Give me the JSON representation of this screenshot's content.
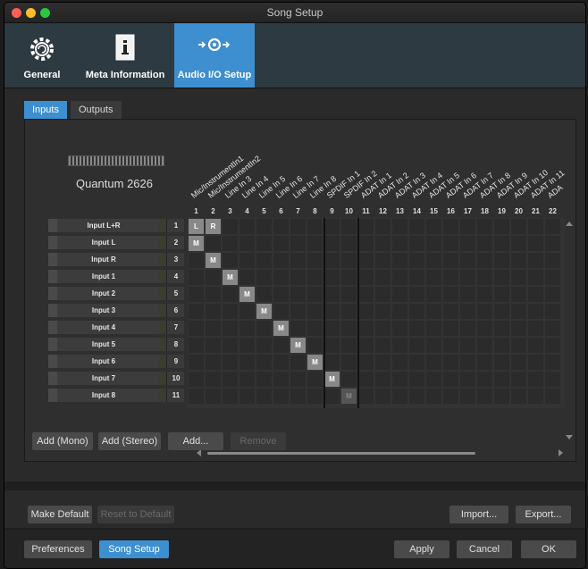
{
  "window": {
    "title": "Song Setup"
  },
  "traffic_lights": {
    "close": "#ff5f57",
    "minimize": "#febc2e",
    "zoom": "#28c840"
  },
  "toolbar": {
    "items": [
      {
        "label": "General",
        "icon": "gear-icon"
      },
      {
        "label": "Meta Information",
        "icon": "info-document-icon"
      },
      {
        "label": "Audio I/O Setup",
        "icon": "audio-io-icon",
        "active": true
      }
    ]
  },
  "tabs": [
    {
      "label": "Inputs",
      "active": true
    },
    {
      "label": "Outputs",
      "active": false
    }
  ],
  "device": {
    "name": "Quantum 2626"
  },
  "columns": [
    {
      "num": "1",
      "name": "Mic/InstrumentIn1"
    },
    {
      "num": "2",
      "name": "Mic/InstrumentIn2"
    },
    {
      "num": "3",
      "name": "Line In 3"
    },
    {
      "num": "4",
      "name": "Line In 4"
    },
    {
      "num": "5",
      "name": "Line In 5"
    },
    {
      "num": "6",
      "name": "Line In 6"
    },
    {
      "num": "7",
      "name": "Line In 7"
    },
    {
      "num": "8",
      "name": "Line In 8"
    },
    {
      "num": "9",
      "name": "SPDIF In 1"
    },
    {
      "num": "10",
      "name": "SPDIF In 2"
    },
    {
      "num": "11",
      "name": "ADAT In 1"
    },
    {
      "num": "12",
      "name": "ADAT In 2"
    },
    {
      "num": "13",
      "name": "ADAT In 3"
    },
    {
      "num": "14",
      "name": "ADAT In 4"
    },
    {
      "num": "15",
      "name": "ADAT In 5"
    },
    {
      "num": "16",
      "name": "ADAT In 6"
    },
    {
      "num": "17",
      "name": "ADAT In 7"
    },
    {
      "num": "18",
      "name": "ADAT In 8"
    },
    {
      "num": "19",
      "name": "ADAT In 9"
    },
    {
      "num": "20",
      "name": "ADAT In 10"
    },
    {
      "num": "21",
      "name": "ADAT In 11"
    },
    {
      "num": "22",
      "name": "ADA"
    }
  ],
  "rows": [
    {
      "name": "Input L+R",
      "num": "1",
      "marks": [
        {
          "col": 0,
          "text": "L"
        },
        {
          "col": 1,
          "text": "R"
        }
      ]
    },
    {
      "name": "Input L",
      "num": "2",
      "marks": [
        {
          "col": 0,
          "text": "M"
        }
      ]
    },
    {
      "name": "Input R",
      "num": "3",
      "marks": [
        {
          "col": 1,
          "text": "M"
        }
      ]
    },
    {
      "name": "Input 1",
      "num": "4",
      "marks": [
        {
          "col": 2,
          "text": "M"
        }
      ]
    },
    {
      "name": "Input 2",
      "num": "5",
      "marks": [
        {
          "col": 3,
          "text": "M"
        }
      ]
    },
    {
      "name": "Input 3",
      "num": "6",
      "marks": [
        {
          "col": 4,
          "text": "M"
        }
      ]
    },
    {
      "name": "Input 4",
      "num": "7",
      "marks": [
        {
          "col": 5,
          "text": "M"
        }
      ]
    },
    {
      "name": "Input 5",
      "num": "8",
      "marks": [
        {
          "col": 6,
          "text": "M"
        }
      ]
    },
    {
      "name": "Input 6",
      "num": "9",
      "marks": [
        {
          "col": 7,
          "text": "M"
        }
      ]
    },
    {
      "name": "Input 7",
      "num": "10",
      "marks": [
        {
          "col": 8,
          "text": "M"
        }
      ]
    },
    {
      "name": "Input 8",
      "num": "11",
      "marks": [
        {
          "col": 9,
          "text": "M",
          "dim": true
        }
      ]
    }
  ],
  "channel_buttons": {
    "add_mono": "Add (Mono)",
    "add_stereo": "Add (Stereo)",
    "add": "Add...",
    "remove": "Remove"
  },
  "default_buttons": {
    "make_default": "Make Default",
    "reset_default": "Reset to Default",
    "import": "Import...",
    "export": "Export..."
  },
  "footer": {
    "preferences": "Preferences",
    "song_setup": "Song Setup",
    "apply": "Apply",
    "cancel": "Cancel",
    "ok": "OK"
  }
}
